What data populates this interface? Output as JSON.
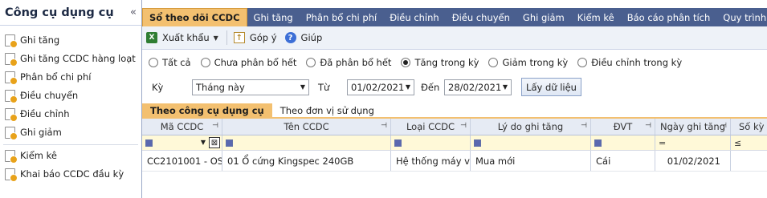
{
  "sidebar": {
    "title": "Công cụ dụng cụ",
    "collapse": "«",
    "items": [
      {
        "label": "Ghi tăng"
      },
      {
        "label": "Ghi tăng CCDC hàng loạt"
      },
      {
        "label": "Phân bổ chi phí"
      },
      {
        "label": "Điều chuyển"
      },
      {
        "label": "Điều chỉnh"
      },
      {
        "label": "Ghi giảm"
      },
      {
        "label": "Kiểm kê"
      },
      {
        "label": "Khai báo CCDC đầu kỳ"
      }
    ]
  },
  "tabs": [
    "Sổ theo dõi CCDC",
    "Ghi tăng",
    "Phân bổ chi phí",
    "Điều chỉnh",
    "Điều chuyển",
    "Ghi giảm",
    "Kiểm kê",
    "Báo cáo phân tích",
    "Quy trình"
  ],
  "toolbar": {
    "export": "Xuất khẩu",
    "feedback": "Góp ý",
    "help": "Giúp"
  },
  "filter": {
    "radios": [
      "Tất cả",
      "Chưa phân bổ hết",
      "Đã phân bổ hết",
      "Tăng trong kỳ",
      "Giảm trong kỳ",
      "Điều chỉnh trong kỳ"
    ],
    "selected_radio": "Tăng trong kỳ",
    "period_label": "Kỳ",
    "period_value": "Tháng này",
    "from_label": "Từ",
    "from_value": "01/02/2021",
    "to_label": "Đến",
    "to_value": "28/02/2021",
    "fetch_button": "Lấy dữ liệu"
  },
  "subtabs": [
    "Theo công cụ dụng cụ",
    "Theo đơn vị sử dụng"
  ],
  "grid": {
    "columns": [
      "Mã CCDC",
      "Tên CCDC",
      "Loại CCDC",
      "Lý do ghi tăng",
      "ĐVT",
      "Ngày ghi tăng",
      "Số kỳ p"
    ],
    "filter_symbols": {
      "date": "=",
      "periods": "≤"
    },
    "rows": [
      {
        "code": "CC2101001 - OS",
        "name": "01 Ổ cứng Kingspec 240GB",
        "type": "Hệ thống máy vi tí",
        "reason": "Mua mới",
        "unit": "Cái",
        "date": "01/02/2021",
        "periods": ""
      }
    ]
  }
}
